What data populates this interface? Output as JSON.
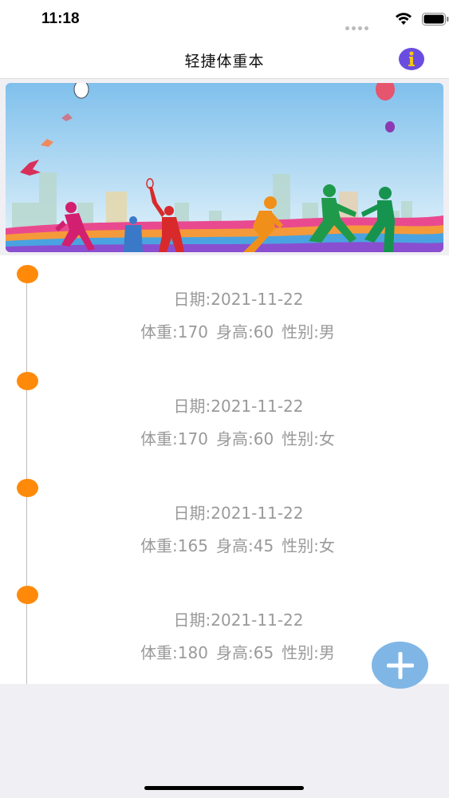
{
  "status_bar": {
    "time": "11:18"
  },
  "nav": {
    "title": "轻捷体重本",
    "info_icon": "info-icon"
  },
  "colors": {
    "accent_orange": "#ff8a0a",
    "add_button": "#7fb6e6",
    "info_button": "#6a4de0"
  },
  "records": [
    {
      "date": "日期:2021-11-22",
      "weight": "体重:170",
      "height": "身高:60",
      "gender": "性别:男"
    },
    {
      "date": "日期:2021-11-22",
      "weight": "体重:170",
      "height": "身高:60",
      "gender": "性别:女"
    },
    {
      "date": "日期:2021-11-22",
      "weight": "体重:165",
      "height": "身高:45",
      "gender": "性别:女"
    },
    {
      "date": "日期:2021-11-22",
      "weight": "体重:180",
      "height": "身高:65",
      "gender": "性别:男"
    }
  ],
  "add_button": {
    "icon": "plus-icon"
  }
}
